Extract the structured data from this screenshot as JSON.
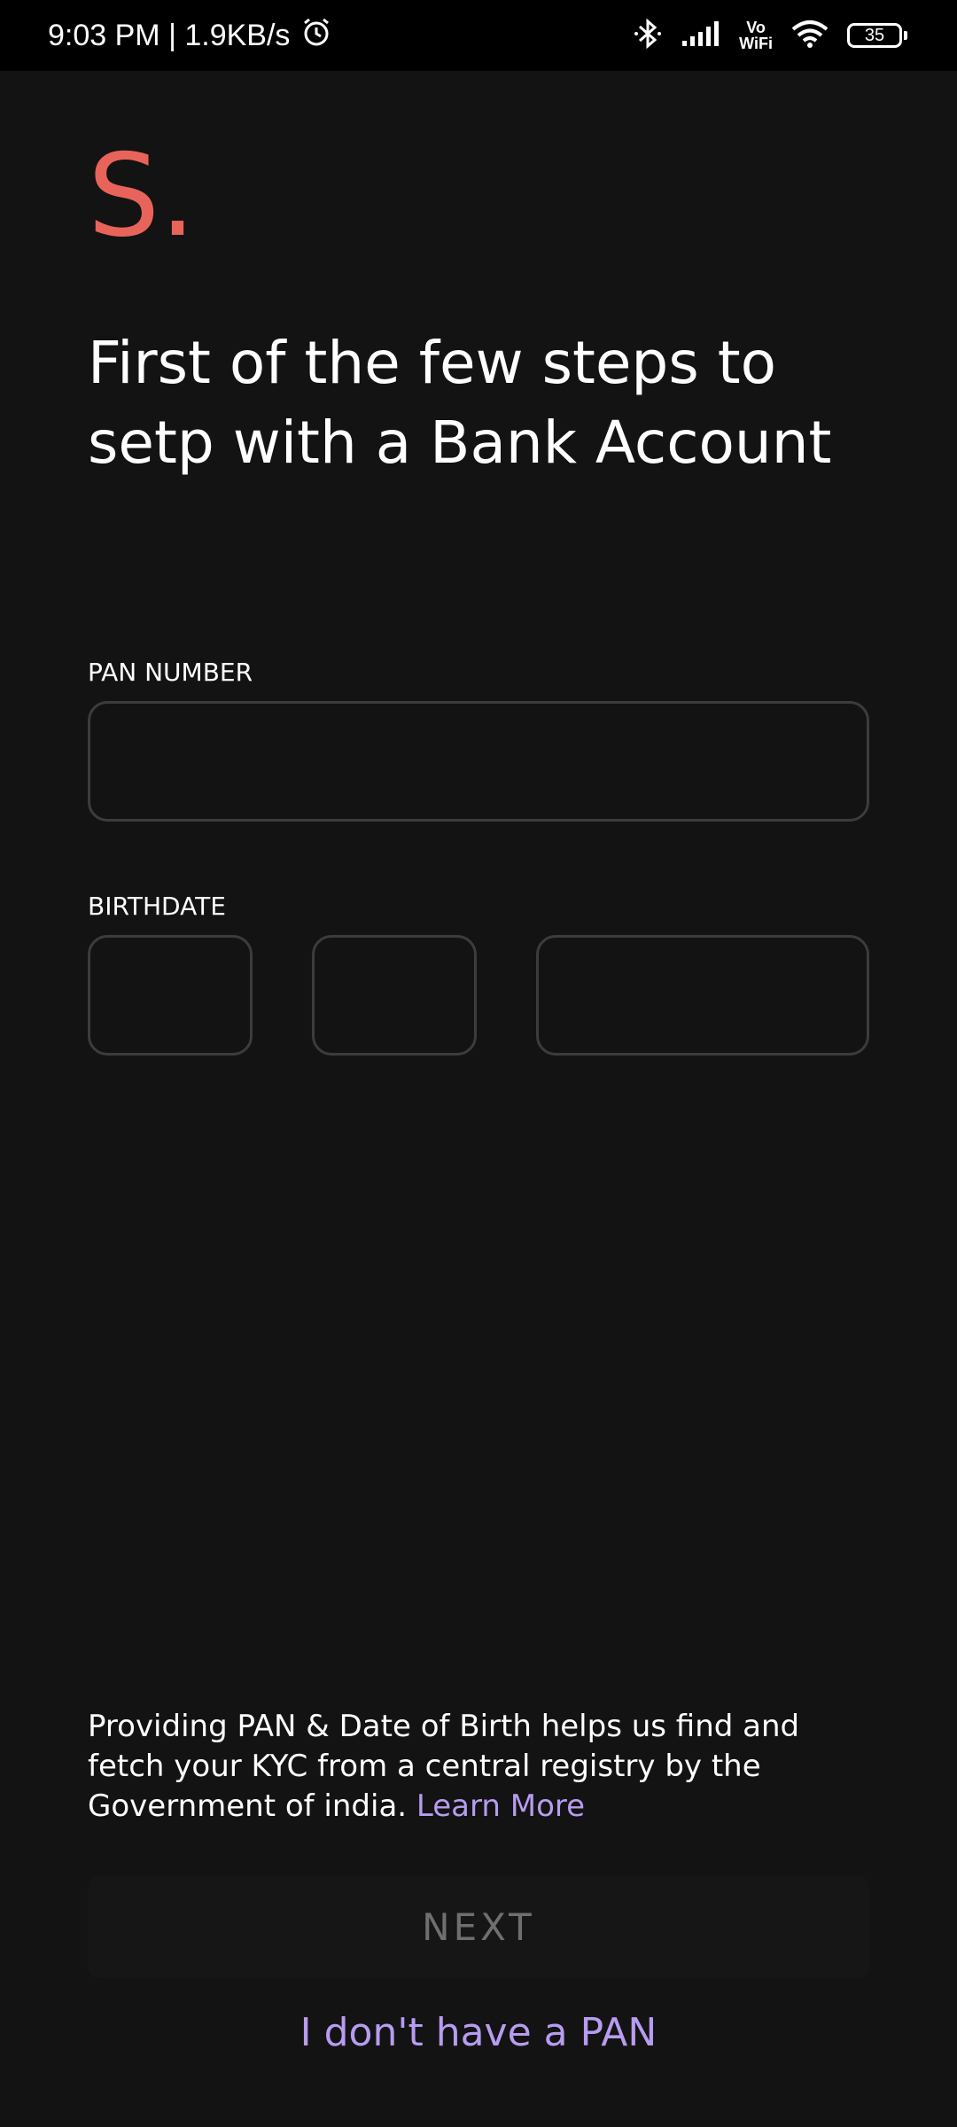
{
  "status_bar": {
    "time_speed": "9:03 PM | 1.9KB/s",
    "alarm_icon": "alarm-clock-icon",
    "bluetooth_icon": "bluetooth-icon",
    "signal_icon": "cell-signal-icon",
    "vowifi_line1": "Vo",
    "vowifi_line2": "WiFi",
    "wifi_icon": "wifi-icon",
    "battery_level": "35"
  },
  "brand": {
    "logo_text": "S.",
    "logo_color": "#e8645a"
  },
  "headline": "First of the few steps to setp with a Bank Account",
  "form": {
    "pan_label": "PAN NUMBER",
    "pan_value": "",
    "birthdate_label": "BIRTHDATE",
    "day_value": "",
    "month_value": "",
    "year_value": ""
  },
  "info": {
    "text": "Providing PAN & Date of Birth helps us find and fetch your KYC from a central registry by the Government of india.",
    "learn_more": "Learn More"
  },
  "actions": {
    "next_label": "NEXT",
    "no_pan_label": "I don't have a PAN"
  },
  "colors": {
    "background": "#131313",
    "accent": "#b79cf0",
    "input_border": "#3c3c3c",
    "disabled_text": "#6f6f6f"
  }
}
